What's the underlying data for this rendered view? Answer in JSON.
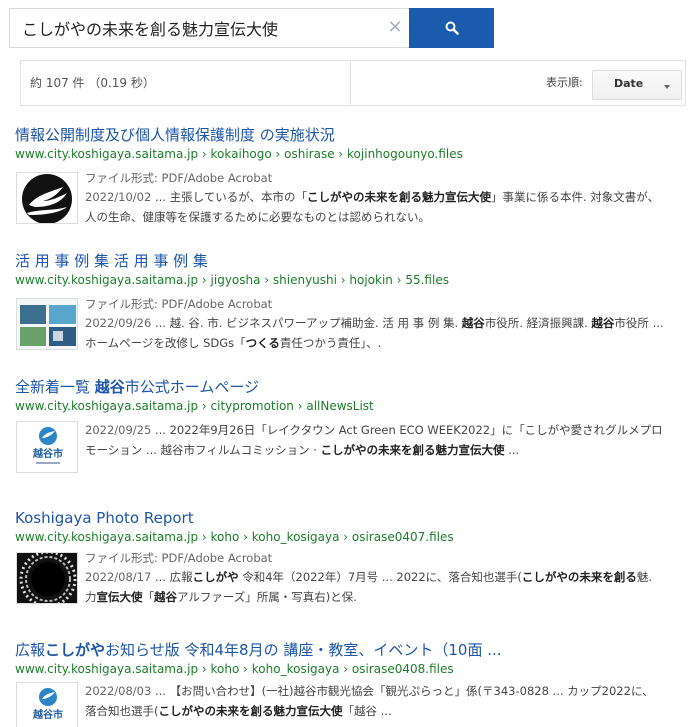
{
  "search": {
    "query": "こしがやの未来を創る魅力宣伝大使",
    "clear_glyph": "×"
  },
  "results_bar": {
    "count_text": "約 107 件 （0.19 秒）",
    "sort_label": "表示順:",
    "sort_value": "Date"
  },
  "colors": {
    "link": "#1e56a8",
    "url": "#1e7d2c",
    "search_button": "#1a5bae"
  },
  "results": [
    {
      "title": "情報公開制度及び個人情報保護制度 の実施状況",
      "url": "www.city.koshigaya.saitama.jp › kokaihogo › oshirase › kojinhogounyo.files",
      "meta": "ファイル形式: PDF/Adobe Acrobat",
      "date": "2022/10/02",
      "snippet_a": " ... 主張しているが、本市の「",
      "snippet_b": "こしがやの未来を創る魅力宣伝大使",
      "snippet_c": "」事業に係る本件. 対象文書が、人の生命、健康等を保護するために必要なものとは認められない。",
      "thumb": "bird-logo-thumbnail"
    },
    {
      "title": "活 用 事 例 集 活 用 事 例 集",
      "url": "www.city.koshigaya.saitama.jp › jigyosha › shienyushi › hojokin › 55.files",
      "meta": "ファイル形式: PDF/Adobe Acrobat",
      "date": "2022/09/26",
      "snippet_a": " ... 越. 谷. 市. ビジネスパワーアップ補助金. 活 用 事 例 集. ",
      "snippet_b": "越谷",
      "snippet_c": "市役所. 経済振興課. ",
      "snippet_d": "越谷",
      "snippet_e": "市役所 ... ホームページを改修し SDGs「",
      "snippet_f": "つくる",
      "snippet_g": "責任つかう責任」、.",
      "thumb": "photo-collage-thumbnail"
    },
    {
      "title_a": "全新着一覧 ",
      "title_b": "越谷",
      "title_c": "市公式ホームページ",
      "url": "www.city.koshigaya.saitama.jp › citypromotion › allNewsList",
      "date": "2022/09/25",
      "snippet_a": " ... 2022年9月26日「レイクタウン Act Green ECO WEEK2022」に「こしがや愛されグルメプロモーション ... 越谷市フィルムコミッション · ",
      "snippet_b": "こしがやの未来を創る魅力宣伝大使",
      "snippet_c": " ...",
      "thumb": "koshigaya-city-logo-thumbnail",
      "thumb_text": "越谷市"
    },
    {
      "title": "Koshigaya Photo Report",
      "url": "www.city.koshigaya.saitama.jp › koho › koho_kosigaya › osirase0407.files",
      "meta": "ファイル形式: PDF/Adobe Acrobat",
      "date": "2022/08/17",
      "snippet_a": " ... 広報",
      "snippet_b": "こしがや",
      "snippet_c": " 令和4年（2022年）7月号 ... 2022に、落合知也選手(",
      "snippet_d": "こしがやの未来を創る",
      "snippet_e": "魅. 力",
      "snippet_f": "宣伝大使",
      "snippet_g": "「",
      "snippet_h": "越谷",
      "snippet_i": "アルファーズ」所属・写真右)と保.",
      "thumb": "lace-pattern-thumbnail"
    },
    {
      "title_a": "広報",
      "title_b": "こしがや",
      "title_c": "お知らせ版 令和4年8月の 講座・教室、イベント（10面 ...",
      "url": "www.city.koshigaya.saitama.jp › koho › koho_kosigaya › osirase0408.files",
      "date": "2022/08/03",
      "snippet_a": " ... 【お問い合わせ】(一社)越谷市観光協会「観光ぷらっと」係(〒343-0828 ... カップ2022に、落合知也選手(",
      "snippet_b": "こしがやの未来を創る魅力宣伝大使",
      "snippet_c": "「越谷 ...",
      "thumb": "koshigaya-city-logo-thumbnail",
      "thumb_text": "越谷市"
    }
  ]
}
